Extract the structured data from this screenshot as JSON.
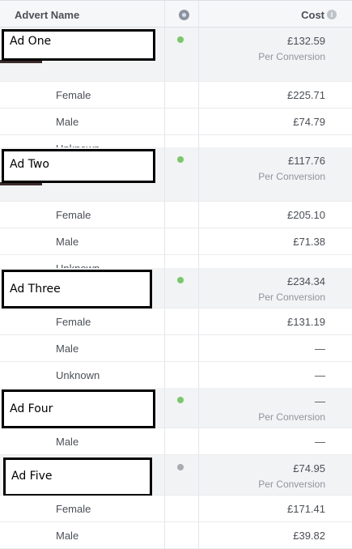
{
  "header": {
    "name_label": "Advert Name",
    "cost_label": "Cost",
    "info_glyph": "i",
    "status_icon": "status-icon"
  },
  "colors": {
    "active_dot": "#7ac86b",
    "inactive_dot": "#a9abb0",
    "ad_row_bg": "#f2f3f5"
  },
  "ads": [
    {
      "name": "Ad One",
      "status": "active",
      "cost": "£132.59",
      "cost_sub": "Per Conversion",
      "breakdown": [
        {
          "label": "Female",
          "value": "£225.71"
        },
        {
          "label": "Male",
          "value": "£74.79"
        },
        {
          "label": "Unknown",
          "value": "—"
        }
      ]
    },
    {
      "name": "Ad Two",
      "status": "active",
      "cost": "£117.76",
      "cost_sub": "Per Conversion",
      "breakdown": [
        {
          "label": "Female",
          "value": "£205.10"
        },
        {
          "label": "Male",
          "value": "£71.38"
        },
        {
          "label": "Unknown",
          "value": "—"
        }
      ]
    },
    {
      "name": "Ad Three",
      "status": "active",
      "cost": "£234.34",
      "cost_sub": "Per Conversion",
      "breakdown": [
        {
          "label": "Female",
          "value": "£131.19"
        },
        {
          "label": "Male",
          "value": "—"
        },
        {
          "label": "Unknown",
          "value": "—"
        }
      ]
    },
    {
      "name": "Ad Four",
      "status": "active",
      "cost": "—",
      "cost_sub": "Per Conversion",
      "breakdown": [
        {
          "label": "Male",
          "value": "—"
        }
      ]
    },
    {
      "name": "Ad Five",
      "status": "inactive",
      "cost": "£74.95",
      "cost_sub": "Per Conversion",
      "breakdown": [
        {
          "label": "Female",
          "value": "£171.41"
        },
        {
          "label": "Male",
          "value": "£39.82"
        }
      ]
    }
  ]
}
